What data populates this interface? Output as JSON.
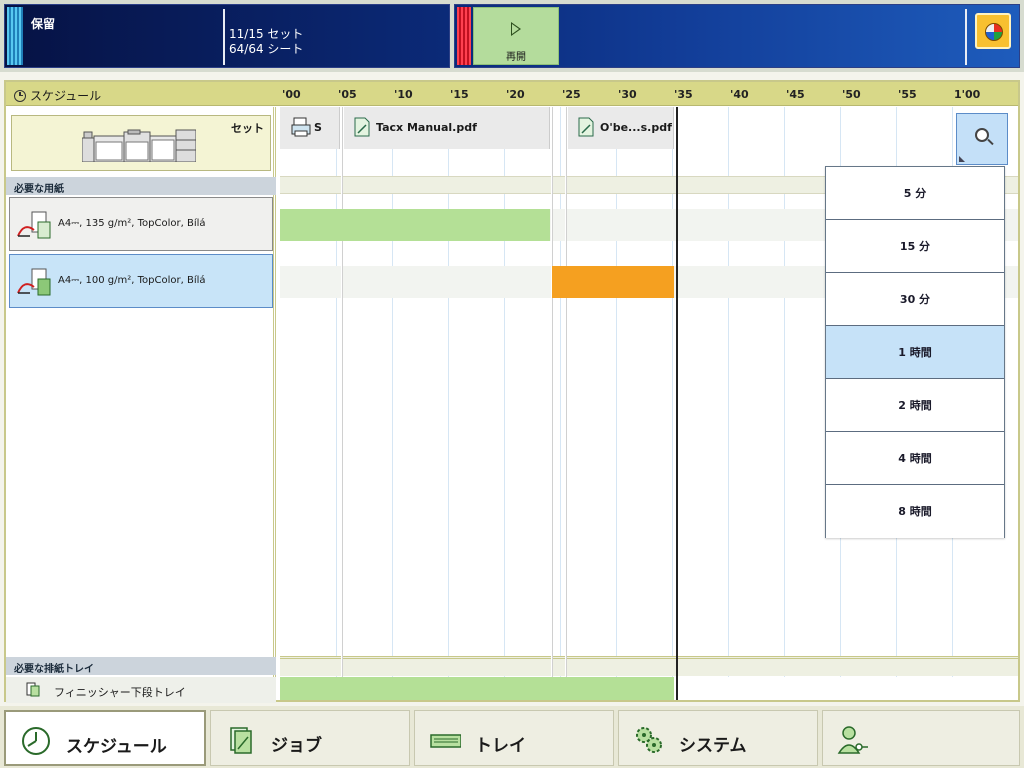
{
  "status": {
    "left_title": "保留",
    "sets": "11/15 セット",
    "sheets": "64/64 シート",
    "resume_label": "再開"
  },
  "schedule": {
    "title": "スケジュール",
    "time_ticks": [
      "'00",
      "'05",
      "'10",
      "'15",
      "'20",
      "'25",
      "'30",
      "'35",
      "'40",
      "'45",
      "'50",
      "'55",
      "1'00"
    ],
    "set_label": "セット",
    "required_media_header": "必要な用紙",
    "media": [
      {
        "label": "A4⎓, 135 g/m², TopColor, Bílá",
        "selected": false
      },
      {
        "label": "A4⎓, 100 g/m², TopColor, Bílá",
        "selected": true
      }
    ],
    "required_tray_header": "必要な排紙トレイ",
    "tray_label": "フィニッシャー下段トレイ",
    "jobs": [
      {
        "label": "S",
        "icon": "printer-job-icon"
      },
      {
        "label": "Tacx Manual.pdf",
        "icon": "pdf-document-icon"
      },
      {
        "label": "O'be...s.pdf",
        "icon": "pdf-document-icon"
      }
    ],
    "colors": {
      "green_bar": "#b4e096",
      "orange_bar": "#f5a020",
      "light_row": "#f2f4f0"
    }
  },
  "zoom_menu": {
    "items": [
      {
        "label": "5 分",
        "active": false
      },
      {
        "label": "15 分",
        "active": false
      },
      {
        "label": "30 分",
        "active": false
      },
      {
        "label": "1 時間",
        "active": true
      },
      {
        "label": "2 時間",
        "active": false
      },
      {
        "label": "4 時間",
        "active": false
      },
      {
        "label": "8 時間",
        "active": false
      }
    ]
  },
  "tabs": [
    {
      "label": "スケジュール",
      "icon": "clock-icon",
      "active": true
    },
    {
      "label": "ジョブ",
      "icon": "document-icon",
      "active": false
    },
    {
      "label": "トレイ",
      "icon": "tray-icon",
      "active": false
    },
    {
      "label": "システム",
      "icon": "gears-icon",
      "active": false
    },
    {
      "label": "",
      "icon": "user-key-icon",
      "active": false
    }
  ]
}
